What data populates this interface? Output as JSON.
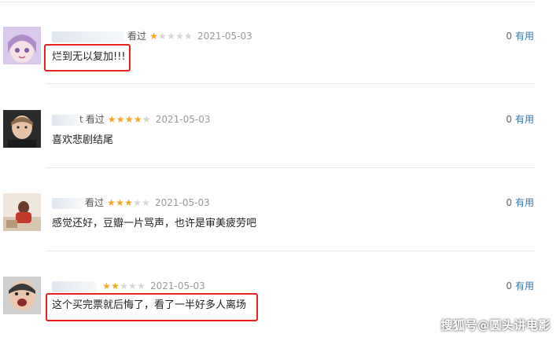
{
  "comments": [
    {
      "user_suffix": "",
      "status": "看过",
      "stars": [
        1,
        0,
        0,
        0,
        0
      ],
      "date": "2021-05-03",
      "vote_count": "0",
      "vote_label": "有用",
      "text": "烂到无以复加!!!"
    },
    {
      "user_suffix": "t",
      "status": "看过",
      "stars": [
        1,
        1,
        1,
        1,
        0
      ],
      "date": "2021-05-03",
      "vote_count": "0",
      "vote_label": "有用",
      "text": "喜欢悲剧结尾"
    },
    {
      "user_suffix": "",
      "status": "看过",
      "stars": [
        1,
        1,
        1,
        0,
        0
      ],
      "date": "2021-05-03",
      "vote_count": "0",
      "vote_label": "有用",
      "text": "感觉还好，豆瓣一片骂声，也许是审美疲劳吧"
    },
    {
      "user_suffix": "",
      "status": "",
      "stars": [
        1,
        1,
        0,
        0,
        0
      ],
      "date": "2021-05-03",
      "vote_count": "0",
      "vote_label": "有用",
      "text": "这个买完票就后悔了，看了一半好多人离场"
    }
  ],
  "icons": {
    "star": "★"
  },
  "colors": {
    "star_on": "#f5a623",
    "star_off": "#d5d5d5",
    "link": "#3377aa",
    "highlight": "#e8231f"
  },
  "watermark": "搜狐号@圆头讲电影"
}
